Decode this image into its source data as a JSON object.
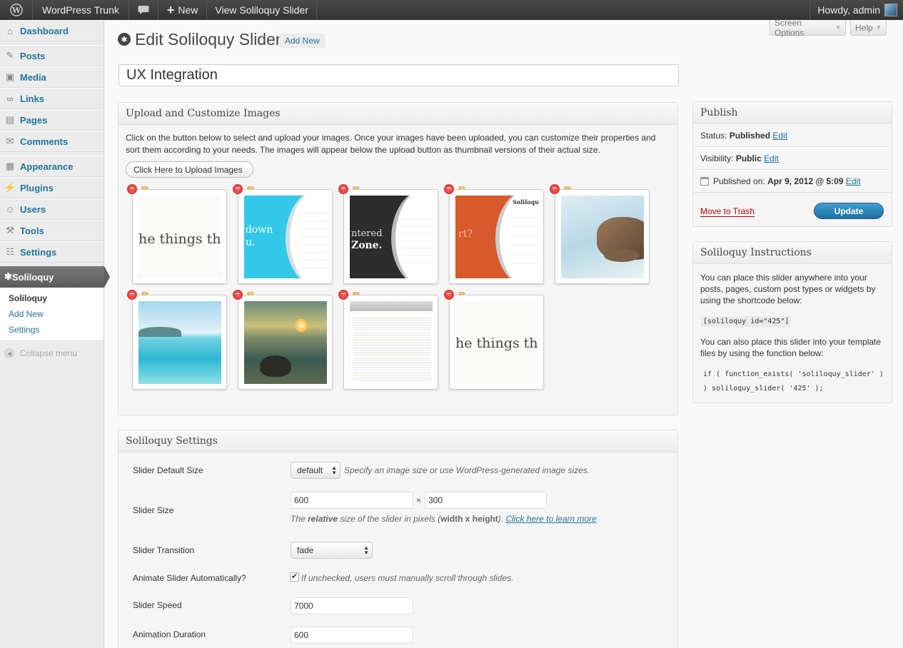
{
  "admin_bar": {
    "site_name": "WordPress Trunk",
    "new_label": "New",
    "view_label": "View Soliloquy Slider",
    "howdy": "Howdy, admin"
  },
  "sidebar": {
    "items": [
      {
        "label": "Dashboard",
        "icon": "dashboard-icon",
        "glyph": "⌂"
      },
      {
        "label": "Posts",
        "icon": "posts-icon",
        "glyph": "✎"
      },
      {
        "label": "Media",
        "icon": "media-icon",
        "glyph": "▣"
      },
      {
        "label": "Links",
        "icon": "links-icon",
        "glyph": "∞"
      },
      {
        "label": "Pages",
        "icon": "pages-icon",
        "glyph": "▤"
      },
      {
        "label": "Comments",
        "icon": "comments-icon",
        "glyph": "✉"
      },
      {
        "label": "Appearance",
        "icon": "appearance-icon",
        "glyph": "▦"
      },
      {
        "label": "Plugins",
        "icon": "plugins-icon",
        "glyph": "⚡"
      },
      {
        "label": "Users",
        "icon": "users-icon",
        "glyph": "☺"
      },
      {
        "label": "Tools",
        "icon": "tools-icon",
        "glyph": "⚒"
      },
      {
        "label": "Settings",
        "icon": "settings-icon",
        "glyph": "☷"
      }
    ],
    "current": "Soliloquy",
    "submenu": [
      "Soliloquy",
      "Add New",
      "Settings"
    ],
    "collapse": "Collapse menu"
  },
  "top_buttons": {
    "screen_options": "Screen Options",
    "help": "Help"
  },
  "heading": {
    "title": "Edit Soliloquy Slider",
    "add_new": "Add New"
  },
  "post_title": "UX Integration",
  "upload_box": {
    "title": "Upload and Customize Images",
    "description": "Click on the button below to select and upload your images. Once your images have been uploaded, you can customize their properties and sort them according to your needs. The images will appear below the upload button as thumbnail versions of their actual size.",
    "button": "Click Here to Upload Images",
    "thumb_texts": {
      "t1": "he things that m",
      "t2_a": "down",
      "t2_b": "u.",
      "t3_a": "ntered",
      "t3_b": "Zone.",
      "t4_a": "Soliloquy Lig",
      "t4_b": "rt?",
      "t9": "he things that m"
    }
  },
  "settings_box": {
    "title": "Soliloquy Settings",
    "default_size_label": "Slider Default Size",
    "default_size_value": "default",
    "default_size_hint": "Specify an image size or use WordPress-generated image sizes.",
    "size_label": "Slider Size",
    "width": "600",
    "times": "×",
    "height": "300",
    "size_hint_pre": "The ",
    "size_hint_bold": "relative",
    "size_hint_mid": " size of the slider in pixels (",
    "size_hint_bold2": "width x height",
    "size_hint_end": "). ",
    "size_hint_link": "Click here to learn more",
    "transition_label": "Slider Transition",
    "transition_value": "fade",
    "animate_label": "Animate Slider Automatically?",
    "animate_hint": "If unchecked, users must manually scroll through slides.",
    "speed_label": "Slider Speed",
    "speed_value": "7000",
    "duration_label": "Animation Duration",
    "duration_value": "600"
  },
  "publish": {
    "title": "Publish",
    "status_label": "Status: ",
    "status_value": "Published",
    "visibility_label": "Visibility: ",
    "visibility_value": "Public",
    "published_label": "Published on: ",
    "published_value": "Apr 9, 2012 @ 5:09",
    "edit": "Edit",
    "trash": "Move to Trash",
    "update": "Update"
  },
  "instructions": {
    "title": "Soliloquy Instructions",
    "p1": "You can place this slider anywhere into your posts, pages, custom post types or widgets by using the shortcode below:",
    "shortcode": "[soliloquy id=\"425\"]",
    "p2": "You can also place this slider into your template files by using the function below:",
    "function_code": "if ( function_exists( 'soliloquy_slider' ) ) soliloquy_slider( '425' );"
  }
}
